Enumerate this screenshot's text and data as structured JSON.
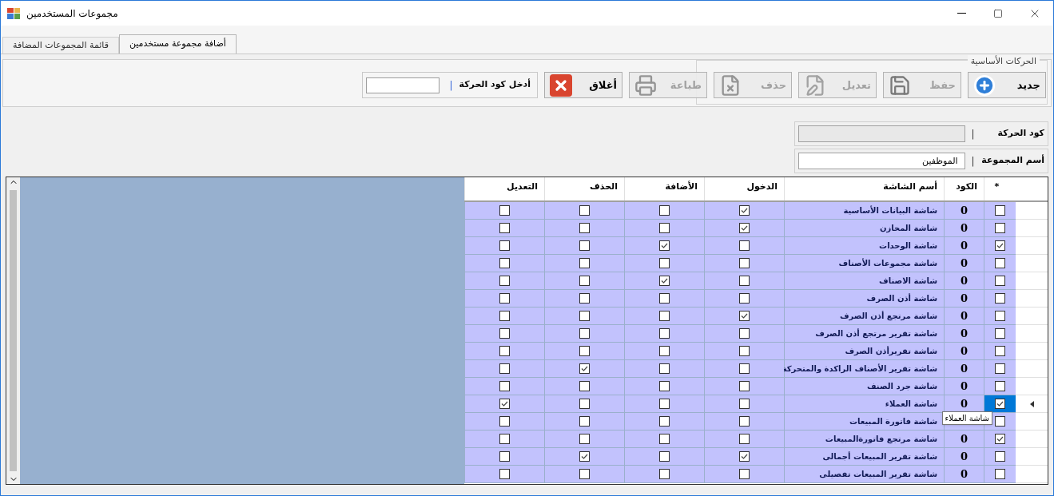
{
  "window": {
    "title": "مجموعات المستخدمين"
  },
  "tabs": [
    {
      "label": "أضافة مجموعة مستخدمين",
      "selected": true
    },
    {
      "label": "قائمة المجموعات المضافة",
      "selected": false
    }
  ],
  "toolbar": {
    "legend": "الحركات الأساسية",
    "buttons": [
      {
        "label": "جديد",
        "kind": "new",
        "disabled": false
      },
      {
        "label": "حفظ",
        "kind": "save",
        "disabled": true
      },
      {
        "label": "تعديل",
        "kind": "edit",
        "disabled": true
      },
      {
        "label": "حذف",
        "kind": "delete",
        "disabled": true
      },
      {
        "label": "طباعة",
        "kind": "print",
        "disabled": true
      },
      {
        "label": "أغلاق",
        "kind": "close",
        "disabled": false
      }
    ],
    "search": {
      "label": "أدخل كود الحركة",
      "separator": "|"
    }
  },
  "fields": [
    {
      "label": "كود الحركة",
      "separator": "|",
      "disabled": true
    },
    {
      "label": "أسم المجموعة",
      "separator": "|",
      "value": "الموظفين",
      "disabled": false
    }
  ],
  "grid": {
    "columns": [
      "*",
      "الكود",
      "أسم الشاشة",
      "الدخول",
      "الأضافة",
      "الحذف",
      "التعديل"
    ],
    "tooltip": "شاشة العملاء",
    "rows": [
      {
        "mark": false,
        "code": "0",
        "name": "شاشة البيانات الأساسية",
        "login": true,
        "add": false,
        "delete": false,
        "edit": false,
        "current": false
      },
      {
        "mark": false,
        "code": "0",
        "name": "شاشة المخازن",
        "login": true,
        "add": false,
        "delete": false,
        "edit": false,
        "current": false
      },
      {
        "mark": true,
        "code": "0",
        "name": "شاشة الوحدات",
        "login": false,
        "add": true,
        "delete": false,
        "edit": false,
        "current": false
      },
      {
        "mark": false,
        "code": "0",
        "name": "شاشة مجموعات الأصناف",
        "login": false,
        "add": false,
        "delete": false,
        "edit": false,
        "current": false
      },
      {
        "mark": false,
        "code": "0",
        "name": "شاشة الاصناف",
        "login": false,
        "add": true,
        "delete": false,
        "edit": false,
        "current": false
      },
      {
        "mark": false,
        "code": "0",
        "name": "شاشة أذن الصرف",
        "login": false,
        "add": false,
        "delete": false,
        "edit": false,
        "current": false
      },
      {
        "mark": false,
        "code": "0",
        "name": "شاشة مرتجع أذن الصرف",
        "login": true,
        "add": false,
        "delete": false,
        "edit": false,
        "current": false
      },
      {
        "mark": false,
        "code": "0",
        "name": "شاشة تقرير مرتجع أذن الصرف",
        "login": false,
        "add": false,
        "delete": false,
        "edit": false,
        "current": false
      },
      {
        "mark": false,
        "code": "0",
        "name": "شاشة تقريرأذن الصرف",
        "login": false,
        "add": false,
        "delete": false,
        "edit": false,
        "current": false
      },
      {
        "mark": false,
        "code": "0",
        "name": "شاشة تقرير الأصناف الراكدة والمتحركة",
        "login": false,
        "add": false,
        "delete": true,
        "edit": false,
        "current": false
      },
      {
        "mark": false,
        "code": "0",
        "name": "شاشة جرد الصنف",
        "login": false,
        "add": false,
        "delete": false,
        "edit": false,
        "current": false
      },
      {
        "mark": true,
        "code": "0",
        "name": "شاشة العملاء",
        "login": false,
        "add": false,
        "delete": false,
        "edit": true,
        "current": true
      },
      {
        "mark": false,
        "name": "شاشة فاتورة المبيعات",
        "login": false,
        "add": false,
        "delete": false,
        "edit": false,
        "current": false
      },
      {
        "mark": true,
        "code": "0",
        "name": "شاشة مرتجع فاتورةالمبيعات",
        "login": false,
        "add": false,
        "delete": false,
        "edit": false,
        "current": false
      },
      {
        "mark": false,
        "code": "0",
        "name": "شاشة تقرير المبيعات أجمالى",
        "login": true,
        "add": false,
        "delete": true,
        "edit": false,
        "current": false
      },
      {
        "mark": false,
        "code": "0",
        "name": "شاشة تقرير المبيعات تفصيلى",
        "login": false,
        "add": false,
        "delete": false,
        "edit": false,
        "current": false
      }
    ]
  }
}
